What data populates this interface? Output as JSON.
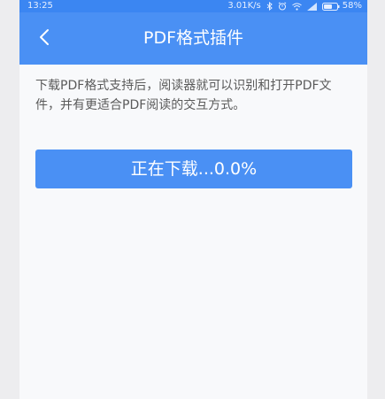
{
  "status_bar": {
    "time": "13:25",
    "net_speed": "3.01K/s",
    "battery_percent": "58%",
    "icons": [
      "bluetooth-icon",
      "alarm-icon",
      "wifi-icon",
      "signal-icon",
      "battery-icon"
    ]
  },
  "app_bar": {
    "back_icon": "chevron-left-icon",
    "title": "PDF格式插件"
  },
  "content": {
    "description": "下载PDF格式支持后，阅读器就可以识别和打开PDF文件，并有更适合PDF阅读的交互方式。",
    "download_button_label": "正在下载...0.0%",
    "download_progress_percent": 0.0
  },
  "colors": {
    "status_bar": "#3b86f2",
    "accent": "#4a90f4",
    "background": "#f8f9fb",
    "text_secondary": "#5a5a5a"
  }
}
